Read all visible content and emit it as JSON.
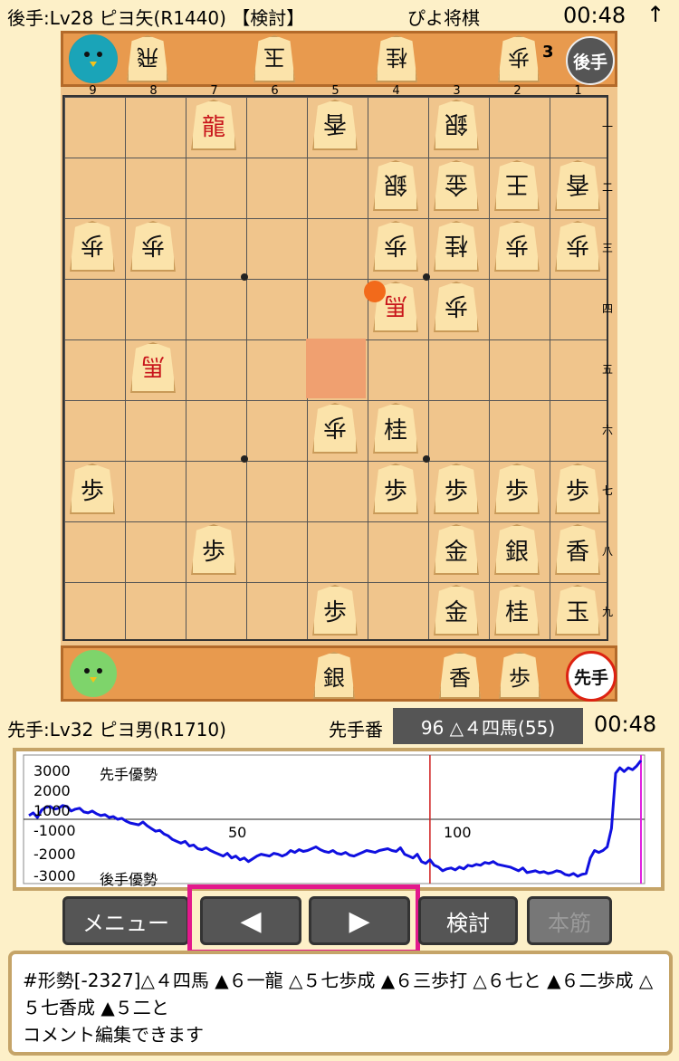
{
  "statusbar": {
    "gote_player": "後手:Lv28 ピヨ矢(R1440) 【検討】",
    "app_title": "ぴよ将棋",
    "clock": "00:48",
    "arrow": "↑"
  },
  "gote_hand": {
    "pieces": [
      "飛",
      "玉",
      "桂",
      "歩"
    ],
    "pawn_count": "3",
    "role": "後手"
  },
  "sente_hand": {
    "pieces": [
      "銀",
      "香",
      "歩"
    ],
    "role": "先手"
  },
  "board": {
    "file_labels": [
      "9",
      "8",
      "7",
      "6",
      "5",
      "4",
      "3",
      "2",
      "1"
    ],
    "rank_labels": [
      "一",
      "二",
      "三",
      "四",
      "五",
      "六",
      "七",
      "八",
      "九"
    ],
    "pieces": [
      {
        "file": 7,
        "rank": 1,
        "kanji": "龍",
        "side": "sente",
        "promoted": true
      },
      {
        "file": 5,
        "rank": 1,
        "kanji": "香",
        "side": "gote",
        "promoted": false
      },
      {
        "file": 3,
        "rank": 1,
        "kanji": "銀",
        "side": "gote",
        "promoted": false
      },
      {
        "file": 4,
        "rank": 2,
        "kanji": "銀",
        "side": "gote",
        "promoted": false
      },
      {
        "file": 3,
        "rank": 2,
        "kanji": "金",
        "side": "gote",
        "promoted": false
      },
      {
        "file": 2,
        "rank": 2,
        "kanji": "王",
        "side": "gote",
        "promoted": false
      },
      {
        "file": 1,
        "rank": 2,
        "kanji": "香",
        "side": "gote",
        "promoted": false
      },
      {
        "file": 9,
        "rank": 3,
        "kanji": "歩",
        "side": "gote",
        "promoted": false
      },
      {
        "file": 8,
        "rank": 3,
        "kanji": "歩",
        "side": "gote",
        "promoted": false
      },
      {
        "file": 4,
        "rank": 3,
        "kanji": "歩",
        "side": "gote",
        "promoted": false
      },
      {
        "file": 3,
        "rank": 3,
        "kanji": "桂",
        "side": "gote",
        "promoted": false
      },
      {
        "file": 2,
        "rank": 3,
        "kanji": "歩",
        "side": "gote",
        "promoted": false
      },
      {
        "file": 1,
        "rank": 3,
        "kanji": "歩",
        "side": "gote",
        "promoted": false
      },
      {
        "file": 4,
        "rank": 4,
        "kanji": "馬",
        "side": "gote",
        "promoted": true
      },
      {
        "file": 3,
        "rank": 4,
        "kanji": "歩",
        "side": "gote",
        "promoted": false
      },
      {
        "file": 8,
        "rank": 5,
        "kanji": "馬",
        "side": "gote",
        "promoted": true
      },
      {
        "file": 5,
        "rank": 6,
        "kanji": "歩",
        "side": "gote",
        "promoted": false
      },
      {
        "file": 4,
        "rank": 6,
        "kanji": "桂",
        "side": "sente",
        "promoted": false
      },
      {
        "file": 9,
        "rank": 7,
        "kanji": "歩",
        "side": "sente",
        "promoted": false
      },
      {
        "file": 4,
        "rank": 7,
        "kanji": "歩",
        "side": "sente",
        "promoted": false
      },
      {
        "file": 3,
        "rank": 7,
        "kanji": "歩",
        "side": "sente",
        "promoted": false
      },
      {
        "file": 2,
        "rank": 7,
        "kanji": "歩",
        "side": "sente",
        "promoted": false
      },
      {
        "file": 1,
        "rank": 7,
        "kanji": "歩",
        "side": "sente",
        "promoted": false
      },
      {
        "file": 7,
        "rank": 8,
        "kanji": "歩",
        "side": "sente",
        "promoted": false
      },
      {
        "file": 3,
        "rank": 8,
        "kanji": "金",
        "side": "sente",
        "promoted": false
      },
      {
        "file": 2,
        "rank": 8,
        "kanji": "銀",
        "side": "sente",
        "promoted": false
      },
      {
        "file": 1,
        "rank": 8,
        "kanji": "香",
        "side": "sente",
        "promoted": false
      },
      {
        "file": 5,
        "rank": 9,
        "kanji": "歩",
        "side": "sente",
        "promoted": false
      },
      {
        "file": 3,
        "rank": 9,
        "kanji": "金",
        "side": "sente",
        "promoted": false
      },
      {
        "file": 2,
        "rank": 9,
        "kanji": "桂",
        "side": "sente",
        "promoted": false
      },
      {
        "file": 1,
        "rank": 9,
        "kanji": "玉",
        "side": "sente",
        "promoted": false
      }
    ],
    "last_move_from": {
      "file": 5,
      "rank": 5
    },
    "last_move_to": {
      "file": 4,
      "rank": 4
    }
  },
  "sente_player": "先手:Lv32 ピヨ男(R1710)",
  "turn_label": "先手番",
  "current_move": "96 △４四馬(55)",
  "sente_clock": "00:48",
  "eval_graph": {
    "y_labels": [
      "3000",
      "2000",
      "1000",
      "-1000",
      "-2000",
      "-3000"
    ],
    "x_labels": [
      "50",
      "100"
    ],
    "sente_adv_label": "先手優勢",
    "gote_adv_label": "後手優勢",
    "line_color": "#1010e0",
    "marker_move": 96,
    "cursor_move": 146,
    "series": [
      200,
      350,
      100,
      500,
      650,
      700,
      550,
      600,
      750,
      700,
      450,
      550,
      600,
      400,
      350,
      450,
      300,
      200,
      250,
      100,
      150,
      0,
      50,
      -100,
      -200,
      -250,
      -300,
      -150,
      -350,
      -500,
      -650,
      -600,
      -800,
      -900,
      -1100,
      -1200,
      -1300,
      -1200,
      -1450,
      -1400,
      -1600,
      -1650,
      -1550,
      -1700,
      -1800,
      -1900,
      -2000,
      -1850,
      -2100,
      -2000,
      -2200,
      -2100,
      -2300,
      -2150,
      -2000,
      -1900,
      -1950,
      -2000,
      -1850,
      -1900,
      -2000,
      -1900,
      -1700,
      -1800,
      -1650,
      -1750,
      -1700,
      -1600,
      -1500,
      -1650,
      -1750,
      -1800,
      -1700,
      -1850,
      -1900,
      -1800,
      -1950,
      -2000,
      -1900,
      -1800,
      -1700,
      -1750,
      -1800,
      -1700,
      -1650,
      -1600,
      -1700,
      -1750,
      -1550,
      -1900,
      -2000,
      -2100,
      -1900,
      -2300,
      -2400,
      -2200,
      -2500,
      -2600,
      -2800,
      -2700,
      -2650,
      -2750,
      -2600,
      -2700,
      -2500,
      -2550,
      -2450,
      -2500,
      -2350,
      -2400,
      -2300,
      -2450,
      -2500,
      -2550,
      -2600,
      -2700,
      -2800,
      -2650,
      -2900,
      -2850,
      -2800,
      -2900,
      -2850,
      -2950,
      -2900,
      -2800,
      -2850,
      -3000,
      -3050,
      -2950,
      -3100,
      -3000,
      -2950,
      -2100,
      -1700,
      -1800,
      -1700,
      -1500,
      -500,
      2500,
      2800,
      2600,
      2800,
      2700,
      2900,
      3200
    ]
  },
  "buttons": {
    "menu": "メニュー",
    "prev": "◀",
    "next": "▶",
    "review": "検討",
    "mainline": "本筋"
  },
  "comment": {
    "text": "#形勢[-2327]△４四馬 ▲６一龍 △５七歩成 ▲６三歩打 △６七と ▲６二歩成 △５七香成 ▲５二と",
    "hint": "コメント編集できます"
  }
}
